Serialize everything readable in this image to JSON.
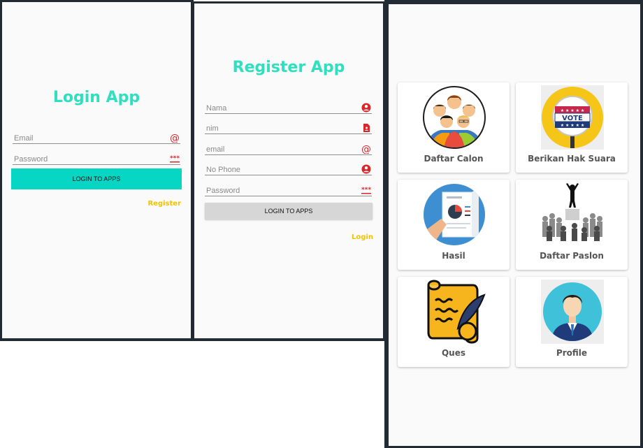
{
  "login": {
    "title": "Login App",
    "email_label": "Email",
    "password_label": "Password",
    "button_label": "LOGIN TO APPS",
    "register_link": "Register",
    "button_color": "#08d6c4"
  },
  "register": {
    "title": "Register App",
    "fields": [
      "Nama",
      "nim",
      "email",
      "No Phone",
      "Password"
    ],
    "button_label": "LOGIN TO APPS",
    "login_link": "Login",
    "button_color": "#d6d6d6"
  },
  "menu": {
    "cards": [
      {
        "label": "Daftar Calon",
        "icon": "candidates-group-icon"
      },
      {
        "label": "Berikan Hak Suara",
        "icon": "vote-badge-icon"
      },
      {
        "label": "Hasil",
        "icon": "report-chart-icon"
      },
      {
        "label": "Daftar Paslon",
        "icon": "crowd-leader-icon"
      },
      {
        "label": "Ques",
        "icon": "scroll-quill-icon"
      },
      {
        "label": "Profile",
        "icon": "user-avatar-icon"
      }
    ],
    "vote_badge_text": "VOTE"
  },
  "colors": {
    "accent_title": "#2fe0c0",
    "icon_red": "#d8262b",
    "link_yellow": "#f2c300",
    "frame": "#222a33"
  }
}
